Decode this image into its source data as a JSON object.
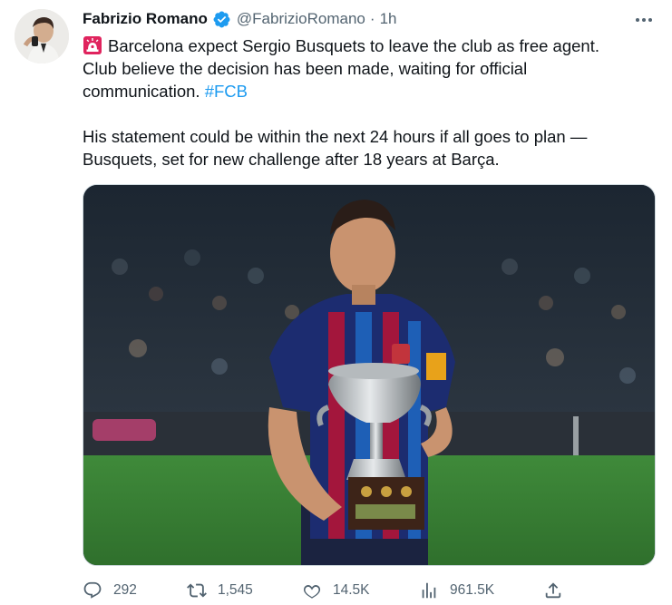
{
  "author": {
    "name": "Fabrizio Romano",
    "handle": "@FabrizioRomano",
    "separator": "·",
    "time": "1h",
    "verified_color": "#1d9bf0"
  },
  "tweet": {
    "line1": "Barcelona expect Sergio Busquets to leave the club as free agent.",
    "line2": "Club believe the decision has been made, waiting for official",
    "line3_text": "communication. ",
    "hashtag": "#FCB",
    "line4": "His statement could be within the next 24 hours if all goes to plan —",
    "line5": "Busquets, set for new challenge after 18 years at Barça.",
    "emoji_icon": "police-siren-icon"
  },
  "actions": {
    "replies": "292",
    "retweets": "1,545",
    "likes": "14.5K",
    "views": "961.5K"
  },
  "colors": {
    "text": "#0f1419",
    "secondary": "#536471",
    "link": "#1d9bf0",
    "siren_red": "#e0245e"
  },
  "icons": [
    "more-icon",
    "verified-badge-icon",
    "police-siren-icon",
    "reply-icon",
    "retweet-icon",
    "like-icon",
    "views-icon",
    "share-icon"
  ]
}
